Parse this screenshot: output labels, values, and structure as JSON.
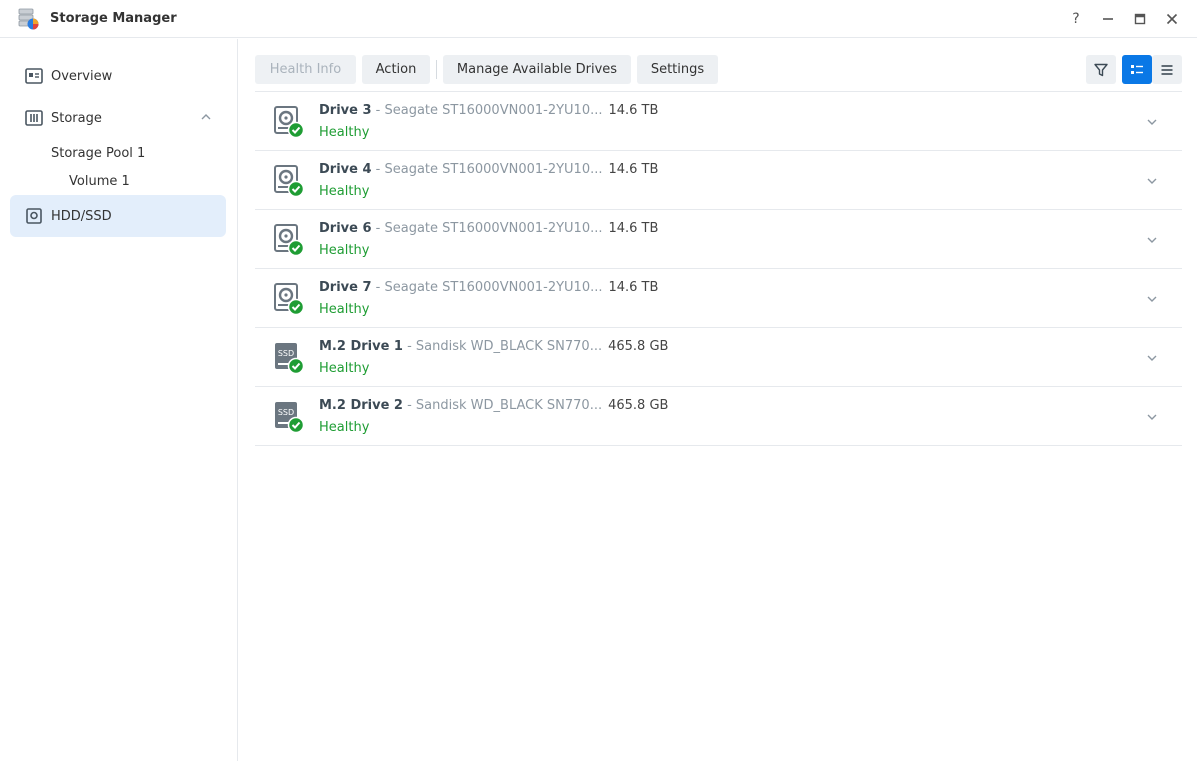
{
  "window": {
    "title": "Storage Manager",
    "controls": {
      "help": "?"
    }
  },
  "sidebar": {
    "items": [
      {
        "label": "Overview",
        "icon": "overview-icon"
      },
      {
        "label": "Storage",
        "icon": "storage-icon",
        "expanded": true
      },
      {
        "label": "HDD/SSD",
        "icon": "hdd-icon",
        "active": true
      }
    ],
    "sub_items": [
      {
        "label": "Storage Pool 1"
      },
      {
        "label": "Volume 1"
      }
    ]
  },
  "toolbar": {
    "health_info": "Health Info",
    "action": "Action",
    "manage_drives": "Manage Available Drives",
    "settings": "Settings"
  },
  "drives": [
    {
      "name": "Drive 3",
      "model": " - Seagate ST16000VN001-2YU10...",
      "size": "14.6 TB",
      "status": "Healthy",
      "type": "hdd"
    },
    {
      "name": "Drive 4",
      "model": " - Seagate ST16000VN001-2YU10...",
      "size": "14.6 TB",
      "status": "Healthy",
      "type": "hdd"
    },
    {
      "name": "Drive 6",
      "model": " - Seagate ST16000VN001-2YU10...",
      "size": "14.6 TB",
      "status": "Healthy",
      "type": "hdd"
    },
    {
      "name": "Drive 7",
      "model": " - Seagate ST16000VN001-2YU10...",
      "size": "14.6 TB",
      "status": "Healthy",
      "type": "hdd"
    },
    {
      "name": "M.2 Drive 1",
      "model": " - Sandisk WD_BLACK SN770...",
      "size": "465.8 GB",
      "status": "Healthy",
      "type": "ssd",
      "badge": "SSD"
    },
    {
      "name": "M.2 Drive 2",
      "model": " - Sandisk WD_BLACK SN770...",
      "size": "465.8 GB",
      "status": "Healthy",
      "type": "ssd",
      "badge": "SSD"
    }
  ],
  "colors": {
    "accent": "#0a78e6",
    "healthy": "#1f9d34",
    "active_nav": "#e3eefb"
  }
}
